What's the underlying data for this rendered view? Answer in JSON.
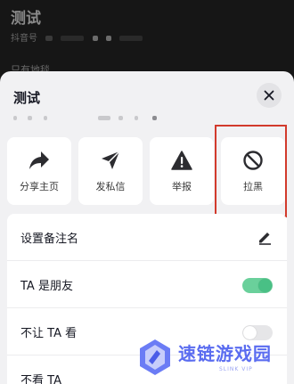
{
  "background": {
    "profile_name": "测试",
    "account_prefix": "抖音号",
    "section_label": "只有地毯"
  },
  "sheet": {
    "title": "测试",
    "close_icon": "close-icon"
  },
  "actions": [
    {
      "label": "分享主页",
      "icon": "share-icon"
    },
    {
      "label": "发私信",
      "icon": "send-message-icon"
    },
    {
      "label": "举报",
      "icon": "report-warning-icon"
    },
    {
      "label": "拉黑",
      "icon": "block-icon"
    }
  ],
  "settings": {
    "remark": {
      "label": "设置备注名",
      "icon": "edit-icon"
    },
    "friend": {
      "label": "TA 是朋友",
      "toggle": "on"
    },
    "hide_from": {
      "label": "不让 TA 看",
      "toggle": "off"
    },
    "not_watch": {
      "label": "不看 TA"
    }
  },
  "watermark": {
    "text": "速链游戏园",
    "subtext": "SLINK VIP"
  },
  "colors": {
    "toggle_on": "#6ad09b",
    "highlight": "#d23a2c",
    "watermark": "#5a6cf0"
  }
}
